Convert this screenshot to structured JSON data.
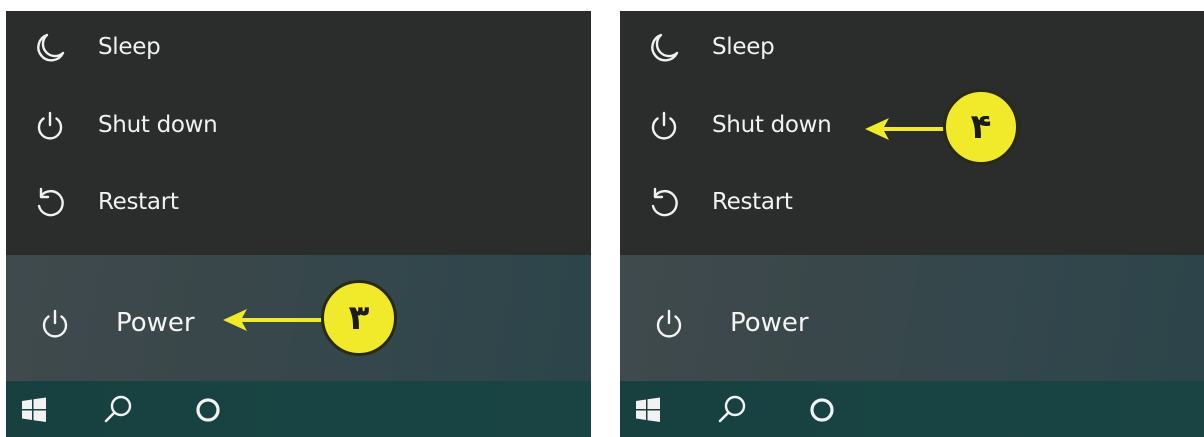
{
  "colors": {
    "menu_bg": "#2b2c2c",
    "text": "#f1f1f1",
    "callout_yellow": "#f1ea2a",
    "taskbar": "#184443"
  },
  "panels": [
    {
      "menu": {
        "sleep": {
          "label": "Sleep",
          "icon": "moon-icon"
        },
        "shutdown": {
          "label": "Shut down",
          "icon": "power-icon"
        },
        "restart": {
          "label": "Restart",
          "icon": "restart-icon"
        }
      },
      "power": {
        "label": "Power",
        "icon": "power-icon"
      },
      "callout": {
        "number": "۳",
        "target": "Power"
      },
      "taskbar": {
        "icons": [
          "windows-logo-icon",
          "search-icon",
          "cortana-icon"
        ]
      }
    },
    {
      "menu": {
        "sleep": {
          "label": "Sleep",
          "icon": "moon-icon"
        },
        "shutdown": {
          "label": "Shut down",
          "icon": "power-icon"
        },
        "restart": {
          "label": "Restart",
          "icon": "restart-icon"
        }
      },
      "power": {
        "label": "Power",
        "icon": "power-icon"
      },
      "callout": {
        "number": "۴",
        "target": "Shut down"
      },
      "taskbar": {
        "icons": [
          "windows-logo-icon",
          "search-icon",
          "cortana-icon"
        ]
      }
    }
  ]
}
